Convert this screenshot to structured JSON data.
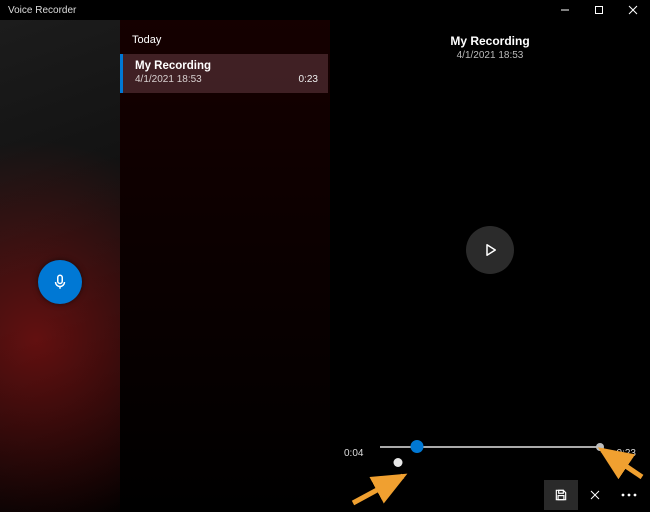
{
  "app": {
    "title": "Voice Recorder"
  },
  "list": {
    "group_label": "Today",
    "items": [
      {
        "title": "My Recording",
        "date": "4/1/2021 18:53",
        "duration": "0:23"
      }
    ]
  },
  "playback": {
    "title": "My Recording",
    "date": "4/1/2021 18:53",
    "current_time": "0:04",
    "total_time": "0:23",
    "playhead_percent": 17,
    "markers_percent": [
      8
    ]
  },
  "icons": {
    "record": "microphone-icon",
    "play": "play-icon",
    "save": "save-icon",
    "trim": "trim-icon",
    "delete": "delete-icon",
    "more": "more-icon",
    "minimize": "minimize-icon",
    "maximize": "maximize-icon",
    "close": "close-icon"
  },
  "colors": {
    "accent": "#0078d4",
    "annotation": "#f0a030"
  }
}
